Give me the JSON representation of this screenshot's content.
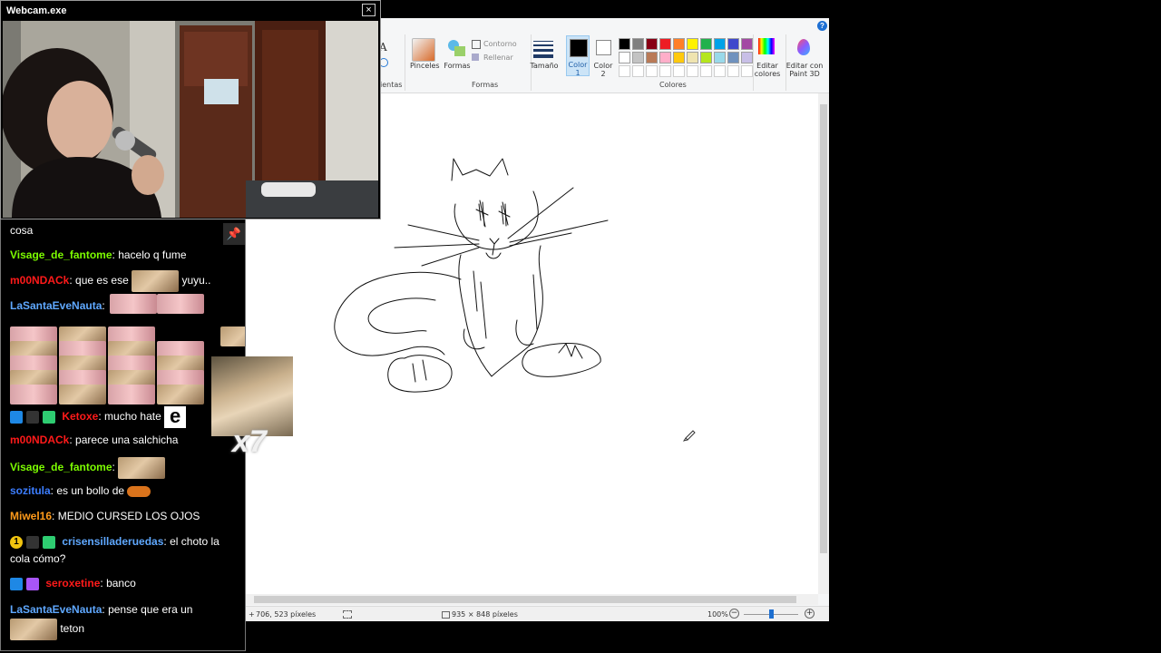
{
  "webcam": {
    "title": "Webcam.exe",
    "close_glyph": "×"
  },
  "paint": {
    "ribbon": {
      "tools_label_partial": "ientas",
      "brushes_label": "Pinceles",
      "shapes_label": "Formas",
      "outline_label": "Contorno",
      "fill_label": "Rellenar",
      "shapes_group_label": "Formas",
      "size_label": "Tamaño",
      "color1_label": "Color",
      "color1_num": "1",
      "color2_label": "Color",
      "color2_num": "2",
      "palette_row1": [
        "#000000",
        "#7f7f7f",
        "#880015",
        "#ed1c24",
        "#ff7f27",
        "#fff200",
        "#22b14c",
        "#00a2e8",
        "#3f48cc",
        "#a349a4"
      ],
      "palette_row2": [
        "#ffffff",
        "#c3c3c3",
        "#b97a57",
        "#ffaec9",
        "#ffc90e",
        "#efe4b0",
        "#b5e61d",
        "#99d9ea",
        "#7092be",
        "#c8bfe7"
      ],
      "colors_group_label": "Colores",
      "edit_colors_label1": "Editar",
      "edit_colors_label2": "colores",
      "paint3d_label1": "Editar con",
      "paint3d_label2": "Paint 3D",
      "help_glyph": "?",
      "text_tool_glyph": "A"
    },
    "status": {
      "cursor_pos": "706, 523 píxeles",
      "image_size": "935 × 848 píxeles",
      "zoom": "100%",
      "zoom_out": "−",
      "zoom_in": "+"
    }
  },
  "chat": {
    "messages": [
      {
        "user": "",
        "text": "cosa",
        "color": "#ffffff"
      },
      {
        "user": "Visage_de_fantome",
        "text": "hacelo q fume",
        "color": "#7cfc00"
      },
      {
        "user": "m00NDACk",
        "text": "que es ese",
        "text2": "yuyu..",
        "color": "#ff1a1a"
      },
      {
        "user": "LaSantaEveNauta",
        "text": "",
        "color": "#5fa8ff"
      },
      {
        "user": "Ketoxe",
        "text": "mucho hate",
        "color": "#ff1a1a"
      },
      {
        "user": "m00NDACk",
        "text": "parece una salchicha",
        "color": "#ff1a1a"
      },
      {
        "user": "Visage_de_fantome",
        "text": "",
        "color": "#7cfc00"
      },
      {
        "user": "sozitula",
        "text": "es un bollo de",
        "color": "#3c7dff"
      },
      {
        "user": "Miwel16",
        "text": "MEDIO CURSED LOS OJOS",
        "color": "#ff9a1a"
      },
      {
        "user": "crisensilladeruedas",
        "text": "el choto la",
        "text2": "cola cómo?",
        "color": "#5fa8ff"
      },
      {
        "user": "seroxetine",
        "text": "banco",
        "color": "#ff1a1a"
      },
      {
        "user": "LaSantaEveNauta",
        "text": "pense que era un",
        "text2": "teton",
        "color": "#5fa8ff"
      }
    ],
    "colon": ":",
    "pin_glyph": "📌",
    "letter_emote": "e",
    "badge_num": "1",
    "cat_count": "x7"
  }
}
